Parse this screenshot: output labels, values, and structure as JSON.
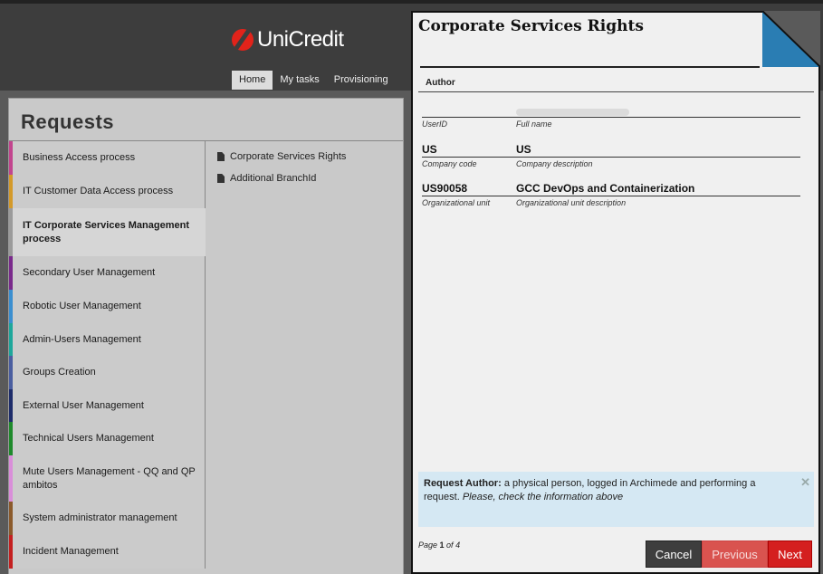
{
  "header": {
    "logo_text": "UniCredit",
    "nav": [
      {
        "label": "Home",
        "active": true
      },
      {
        "label": "My tasks",
        "active": false
      },
      {
        "label": "Provisioning",
        "active": false
      }
    ]
  },
  "requests": {
    "title": "Requests",
    "processes": [
      {
        "label": "Business Access process",
        "color": "#c2458e",
        "active": false
      },
      {
        "label": "IT Customer Data Access process",
        "color": "#d49a2a",
        "active": false
      },
      {
        "label": "IT Corporate Services Management process",
        "color": "#9b9b9b",
        "active": true
      },
      {
        "label": "Secondary User Management",
        "color": "#7a2a8c",
        "active": false
      },
      {
        "label": "Robotic User Management",
        "color": "#3b8fd0",
        "active": false
      },
      {
        "label": "Admin-Users Management",
        "color": "#1ea79b",
        "active": false
      },
      {
        "label": "Groups Creation",
        "color": "#4a5ea0",
        "active": false
      },
      {
        "label": "External User Management",
        "color": "#1e2d6b",
        "active": false
      },
      {
        "label": "Technical Users Management",
        "color": "#1f8a2c",
        "active": false
      },
      {
        "label": "Mute Users Management - QQ and QP ambitos",
        "color": "#d98ed9",
        "active": false
      },
      {
        "label": "System administrator management",
        "color": "#8b5a2b",
        "active": false
      },
      {
        "label": "Incident Management",
        "color": "#c42020",
        "active": false
      }
    ],
    "items": [
      {
        "label": "Corporate Services Rights",
        "icon": "document-icon"
      },
      {
        "label": "Additional BranchId",
        "icon": "document-icon"
      }
    ]
  },
  "modal": {
    "title": "Corporate Services Rights",
    "author_heading": "Author",
    "fields": [
      {
        "value1": "",
        "label1": "UserID",
        "value2": "",
        "label2": "Full name"
      },
      {
        "value1": "US",
        "label1": "Company code",
        "value2": "US",
        "label2": "Company description"
      },
      {
        "value1": "US90058",
        "label1": "Organizational unit",
        "value2": "GCC DevOps and Containerization",
        "label2": "Organizational unit description"
      }
    ],
    "info": {
      "bold": "Request Author:",
      "text": " a physical person, logged in Archimede and performing a request. ",
      "italic": "Please, check the information above"
    },
    "page": {
      "prefix": "Page ",
      "current": "1",
      "middle": " of ",
      "total": "4"
    },
    "buttons": {
      "cancel": "Cancel",
      "previous": "Previous",
      "next": "Next"
    },
    "accent_color": "#2a7db3"
  }
}
